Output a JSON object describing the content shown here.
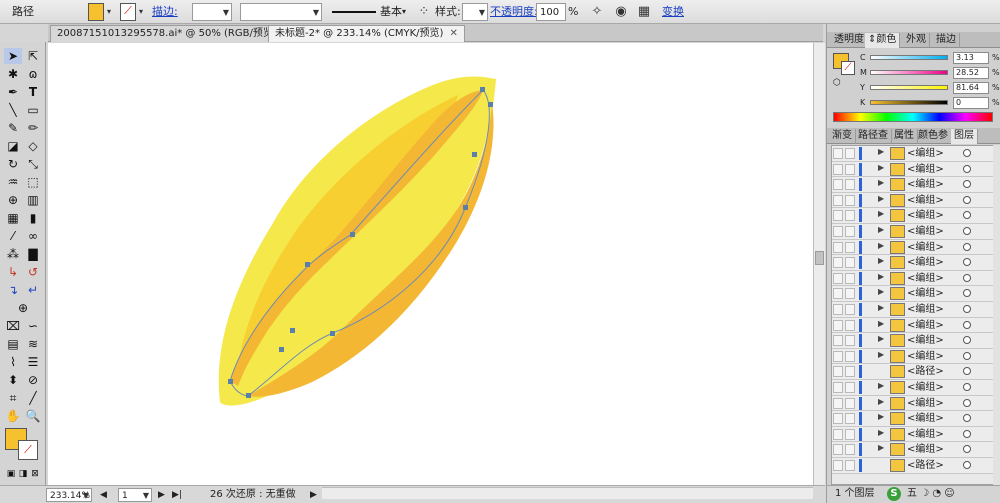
{
  "control_bar": {
    "object_type": "路径",
    "fill_color": "#f6c12e",
    "stroke_label": "描边:",
    "stroke_weight": "",
    "profile_label": "基本",
    "style_label": "样式:",
    "opacity_label": "不透明度:",
    "opacity_value": "100",
    "percent_sign": "%",
    "transform_label": "变换"
  },
  "tabs": [
    {
      "label": "20087151013295578.ai* @ 50% (RGB/预览)"
    },
    {
      "label": "未标题-2* @ 233.14% (CMYK/预览)"
    }
  ],
  "canvas": {
    "leaf_outer": "#f4e84a",
    "leaf_mid": "#f7ca2c",
    "leaf_path": "#f3b733",
    "anchor": "#5a7fa8"
  },
  "status": {
    "zoom": "233.14%",
    "page": "1",
    "undo_text": "26 次还原 : 无重做"
  },
  "color_panel": {
    "tabs": [
      "透明度",
      "颜色",
      "外观",
      "描边"
    ],
    "active_tab": "颜色",
    "channels": [
      {
        "label": "C",
        "value": "3.13"
      },
      {
        "label": "M",
        "value": "28.52"
      },
      {
        "label": "Y",
        "value": "81.64"
      },
      {
        "label": "K",
        "value": "0"
      }
    ],
    "percent": "%",
    "fill": "#f6c12e"
  },
  "layers_panel": {
    "tabs": [
      "渐变",
      "路径查",
      "属性",
      "颜色参",
      "图层"
    ],
    "active_tab": "图层",
    "rows": [
      {
        "name": "<编组>",
        "expandable": true
      },
      {
        "name": "<编组>",
        "expandable": true
      },
      {
        "name": "<编组>",
        "expandable": true
      },
      {
        "name": "<编组>",
        "expandable": true
      },
      {
        "name": "<编组>",
        "expandable": true
      },
      {
        "name": "<编组>",
        "expandable": true
      },
      {
        "name": "<编组>",
        "expandable": true
      },
      {
        "name": "<编组>",
        "expandable": true
      },
      {
        "name": "<编组>",
        "expandable": true
      },
      {
        "name": "<编组>",
        "expandable": true
      },
      {
        "name": "<编组>",
        "expandable": true
      },
      {
        "name": "<编组>",
        "expandable": true
      },
      {
        "name": "<编组>",
        "expandable": true
      },
      {
        "name": "<编组>",
        "expandable": true
      },
      {
        "name": "<路径>",
        "expandable": false
      },
      {
        "name": "<编组>",
        "expandable": true
      },
      {
        "name": "<编组>",
        "expandable": true
      },
      {
        "name": "<编组>",
        "expandable": true
      },
      {
        "name": "<编组>",
        "expandable": true
      },
      {
        "name": "<编组>",
        "expandable": true
      },
      {
        "name": "<路径>",
        "expandable": false
      }
    ],
    "footer": "1 个图层",
    "footer_icons": "五 ☽ ◔ ☺"
  }
}
